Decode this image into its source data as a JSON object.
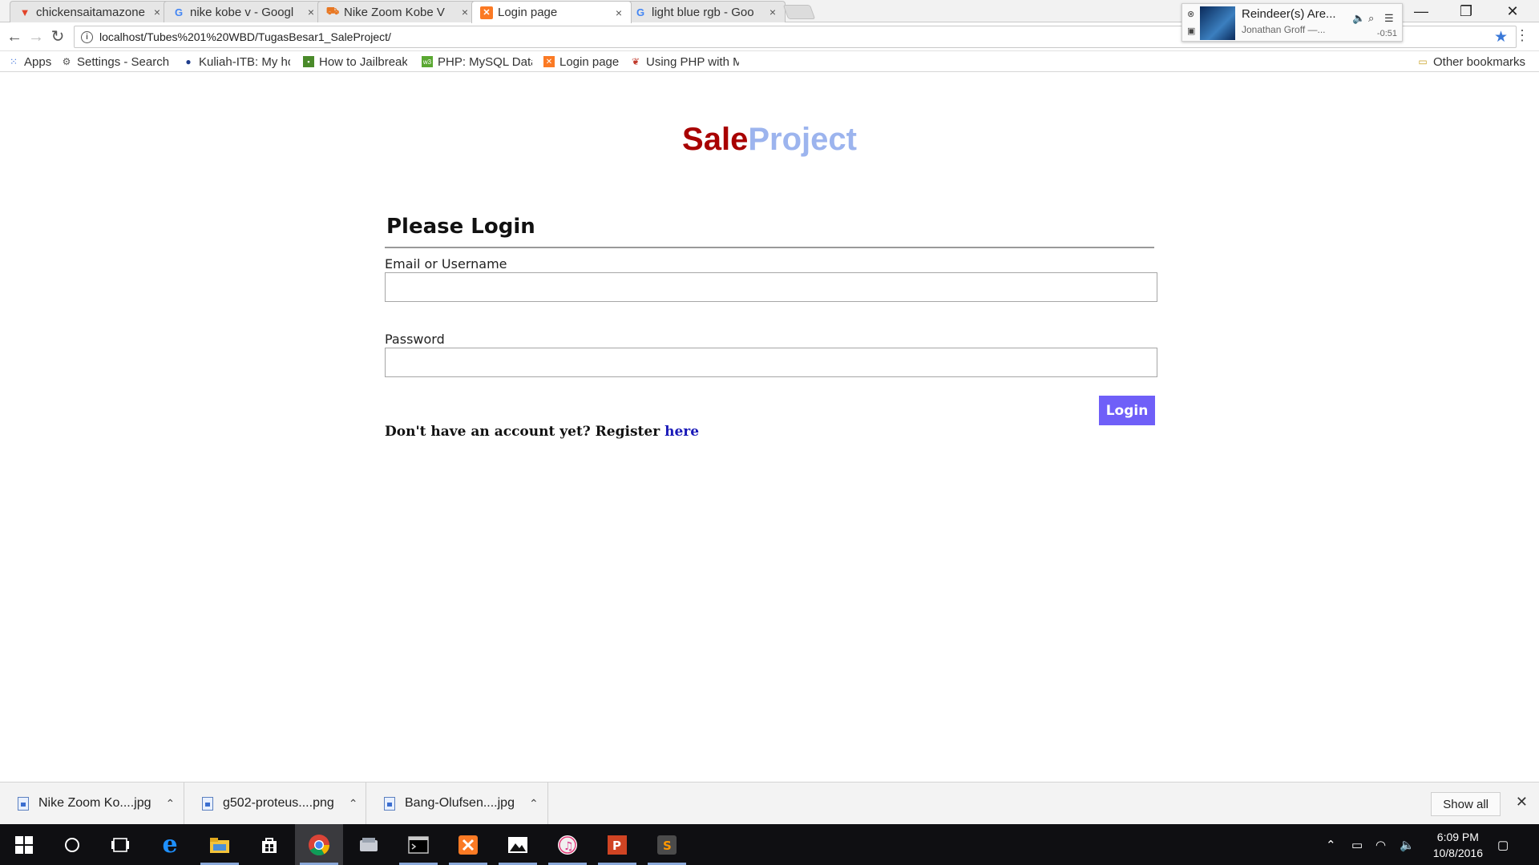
{
  "browser": {
    "tabs": [
      {
        "title": "chickensaitamazone",
        "icon": "gitlab-icon",
        "active": false
      },
      {
        "title": "nike kobe v - Googl",
        "icon": "google-icon",
        "active": false
      },
      {
        "title": "Nike Zoom Kobe V",
        "icon": "cart-icon",
        "active": false
      },
      {
        "title": "Login page",
        "icon": "xampp-icon",
        "active": true
      },
      {
        "title": "light blue rgb - Goo",
        "icon": "google-icon",
        "active": false
      }
    ],
    "close_glyph": "×",
    "url": "localhost/Tubes%201%20WBD/TugasBesar1_SaleProject/",
    "bookmarks": [
      {
        "label": "Apps",
        "icon": "apps-grid-icon"
      },
      {
        "label": "Settings - Search",
        "icon": "gear-icon"
      },
      {
        "label": "Kuliah-ITB: My ho",
        "icon": "itb-icon"
      },
      {
        "label": "How to Jailbreak",
        "icon": "bookmark-site-icon"
      },
      {
        "label": "PHP: MySQL Data",
        "icon": "w3-icon"
      },
      {
        "label": "Login page",
        "icon": "xampp-icon"
      },
      {
        "label": "Using PHP with M",
        "icon": "bird-icon"
      }
    ],
    "other_bookmarks": "Other bookmarks"
  },
  "media_player": {
    "song": "Reindeer(s) Are...",
    "artist": "Jonathan Groff —...",
    "time": "-0:51"
  },
  "page": {
    "brand_sale": "Sale",
    "brand_project": "Project",
    "heading": "Please Login",
    "email_label": "Email or Username",
    "email_value": "",
    "password_label": "Password",
    "password_value": "",
    "login_button": "Login",
    "register_text": "Don't have an account yet? Register ",
    "register_link": "here"
  },
  "downloads": {
    "items": [
      {
        "name": "Nike Zoom Ko....jpg"
      },
      {
        "name": "g502-proteus....png"
      },
      {
        "name": "Bang-Olufsen....jpg"
      }
    ],
    "show_all": "Show all"
  },
  "taskbar": {
    "time": "6:09 PM",
    "date": "10/8/2016",
    "apps": [
      "start-icon",
      "cortana-icon",
      "task-view-icon",
      "edge-icon",
      "file-explorer-icon",
      "store-icon",
      "chrome-icon",
      "app-icon",
      "terminal-icon",
      "xampp-icon",
      "photos-icon",
      "itunes-icon",
      "powerpoint-icon",
      "sublime-icon"
    ]
  },
  "colors": {
    "brand_sale": "#a80000",
    "brand_project": "#9cb4ee",
    "login_button": "#6f5ff8",
    "link": "#1a1ab8"
  }
}
